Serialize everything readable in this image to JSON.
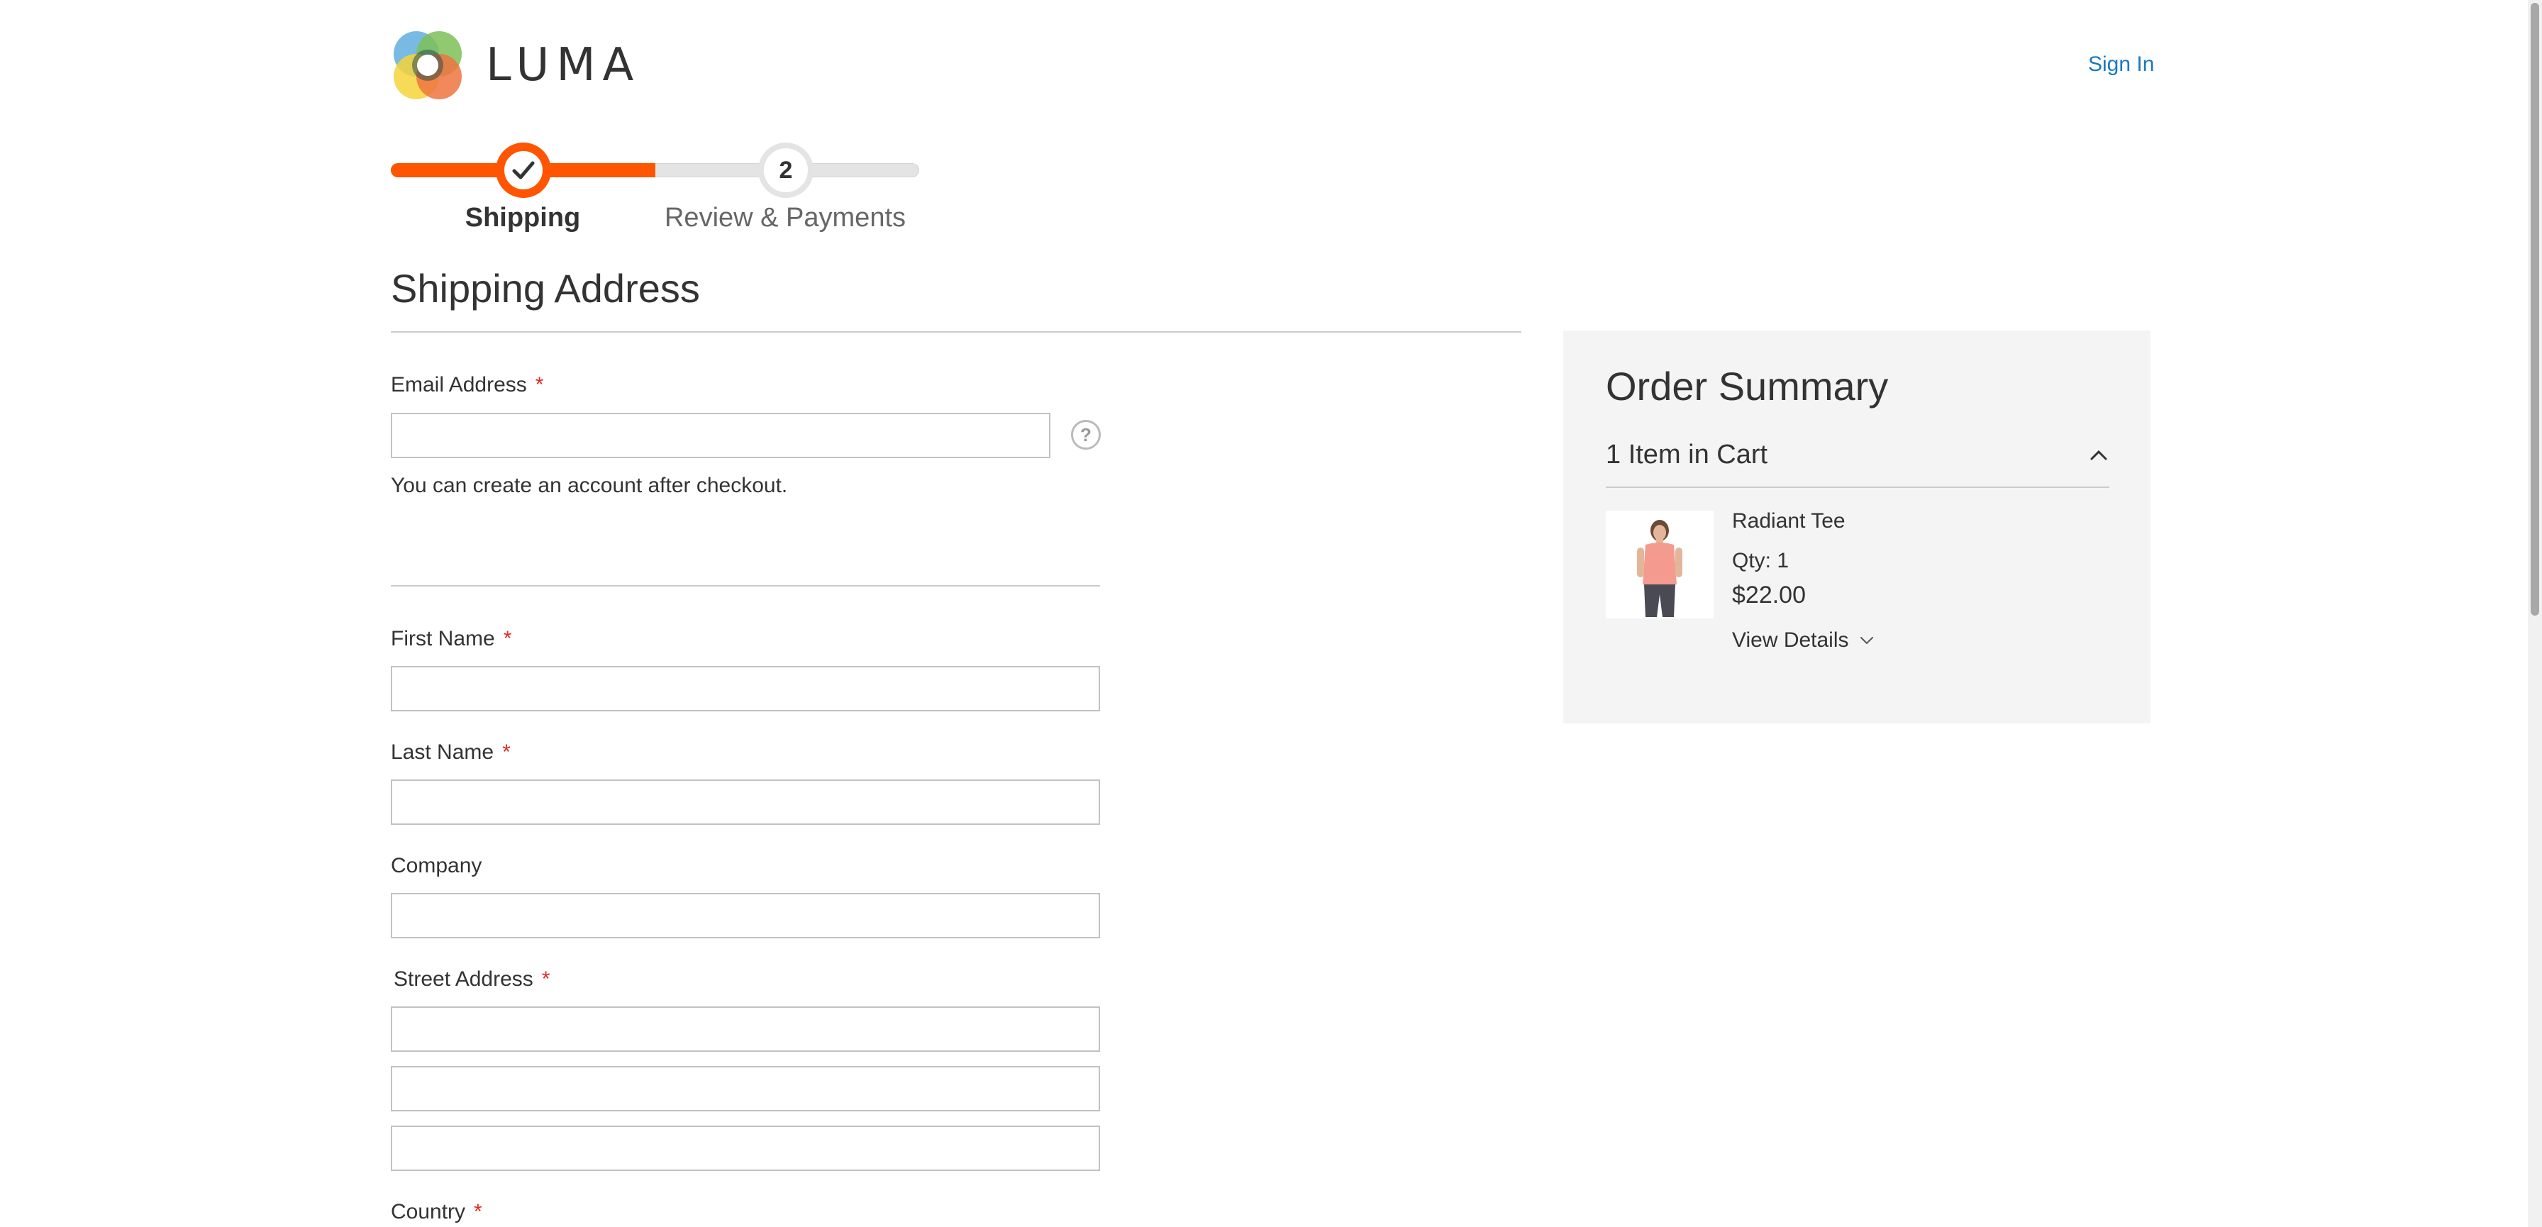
{
  "header": {
    "logo_text": "LUMA",
    "sign_in": "Sign In"
  },
  "progress": {
    "steps": [
      {
        "label": "Shipping",
        "state": "complete"
      },
      {
        "label": "Review & Payments",
        "number": "2",
        "state": "pending"
      }
    ],
    "fill_fraction": 0.5,
    "accent_color": "#ff5501"
  },
  "shipping": {
    "title": "Shipping Address",
    "email_label": "Email Address",
    "required_marker": "*",
    "account_note": "You can create an account after checkout.",
    "first_name_label": "First Name",
    "last_name_label": "Last Name",
    "company_label": "Company",
    "street_label": "Street Address",
    "country_label": "Country",
    "help_glyph": "?"
  },
  "summary": {
    "title": "Order Summary",
    "cart_count": "1 Item in Cart",
    "item": {
      "name": "Radiant Tee",
      "qty": "Qty: 1",
      "price": "$22.00",
      "view_details": "View Details"
    }
  },
  "icons": {
    "check": "check-icon",
    "help": "help-icon",
    "collapse": "chevron-up-icon",
    "expand": "chevron-down-icon"
  }
}
